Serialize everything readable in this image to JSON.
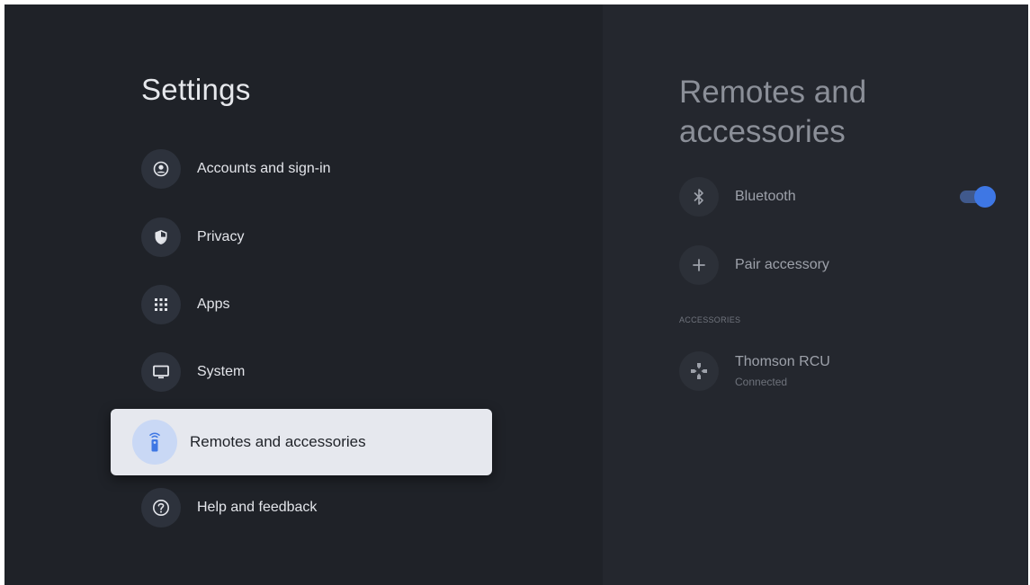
{
  "settings": {
    "title": "Settings",
    "menu": [
      {
        "label": "Accounts and sign-in",
        "icon": "account-circle-icon"
      },
      {
        "label": "Privacy",
        "icon": "shield-icon"
      },
      {
        "label": "Apps",
        "icon": "apps-grid-icon"
      },
      {
        "label": "System",
        "icon": "monitor-icon"
      },
      {
        "label": "Remotes and accessories",
        "icon": "remote-icon",
        "selected": true
      },
      {
        "label": "Help and feedback",
        "icon": "help-icon"
      }
    ]
  },
  "panel": {
    "title": "Remotes and accessories",
    "bluetooth": {
      "label": "Bluetooth",
      "enabled": true
    },
    "pair": {
      "label": "Pair accessory"
    },
    "section_label": "ACCESSORIES",
    "accessory": {
      "name": "Thomson RCU",
      "status": "Connected"
    }
  },
  "colors": {
    "background": "#1f2228",
    "panel_background": "#24272e",
    "selected_background": "#e6e8ee",
    "accent": "#3e77e4"
  }
}
